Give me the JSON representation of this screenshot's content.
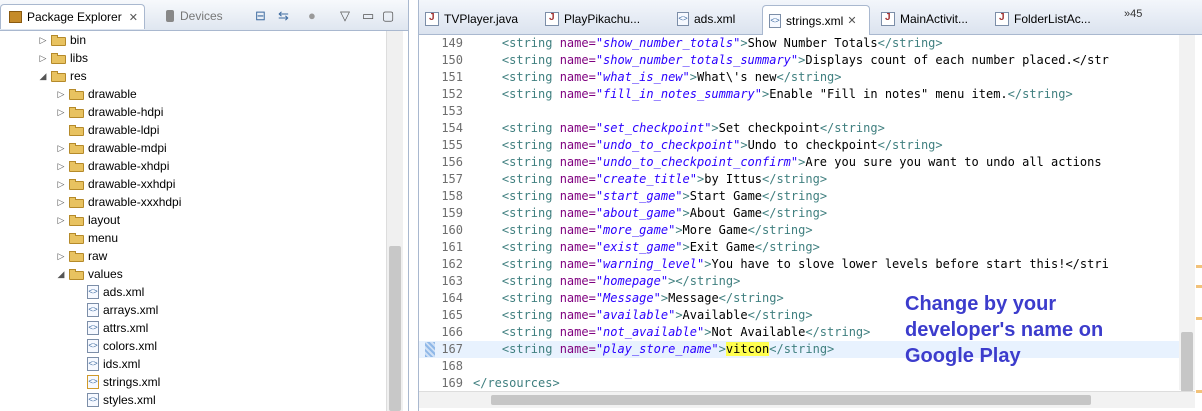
{
  "left_panel": {
    "tabs": [
      {
        "label": "Package Explorer",
        "icon": "package-explorer-icon",
        "active": true
      },
      {
        "label": "Devices",
        "icon": "device-icon",
        "active": false
      }
    ],
    "tree": [
      {
        "label": "bin",
        "type": "folder",
        "depth": 0,
        "state": "collapsed"
      },
      {
        "label": "libs",
        "type": "folder",
        "depth": 0,
        "state": "collapsed"
      },
      {
        "label": "res",
        "type": "folder",
        "depth": 0,
        "state": "expanded"
      },
      {
        "label": "drawable",
        "type": "folder",
        "depth": 1,
        "state": "collapsed"
      },
      {
        "label": "drawable-hdpi",
        "type": "folder",
        "depth": 1,
        "state": "collapsed"
      },
      {
        "label": "drawable-ldpi",
        "type": "folder",
        "depth": 1,
        "state": "none"
      },
      {
        "label": "drawable-mdpi",
        "type": "folder",
        "depth": 1,
        "state": "collapsed"
      },
      {
        "label": "drawable-xhdpi",
        "type": "folder",
        "depth": 1,
        "state": "collapsed"
      },
      {
        "label": "drawable-xxhdpi",
        "type": "folder",
        "depth": 1,
        "state": "collapsed"
      },
      {
        "label": "drawable-xxxhdpi",
        "type": "folder",
        "depth": 1,
        "state": "collapsed"
      },
      {
        "label": "layout",
        "type": "folder",
        "depth": 1,
        "state": "collapsed"
      },
      {
        "label": "menu",
        "type": "folder",
        "depth": 1,
        "state": "none"
      },
      {
        "label": "raw",
        "type": "folder",
        "depth": 1,
        "state": "collapsed"
      },
      {
        "label": "values",
        "type": "folder",
        "depth": 1,
        "state": "expanded"
      },
      {
        "label": "ads.xml",
        "type": "xml",
        "depth": 2
      },
      {
        "label": "arrays.xml",
        "type": "xml",
        "depth": 2
      },
      {
        "label": "attrs.xml",
        "type": "xml",
        "depth": 2
      },
      {
        "label": "colors.xml",
        "type": "xml",
        "depth": 2
      },
      {
        "label": "ids.xml",
        "type": "xml",
        "depth": 2
      },
      {
        "label": "strings.xml",
        "type": "xml",
        "depth": 2,
        "modified": true
      },
      {
        "label": "styles.xml",
        "type": "xml",
        "depth": 2
      }
    ]
  },
  "editor": {
    "tabs": [
      {
        "label": "TVPlayer.java",
        "icon": "java-file-icon"
      },
      {
        "label": "PlayPikachu...",
        "icon": "java-file-icon"
      },
      {
        "label": "ads.xml",
        "icon": "xml-file-icon"
      },
      {
        "label": "strings.xml",
        "icon": "xml-file-icon",
        "active": true
      },
      {
        "label": "MainActivit...",
        "icon": "java-file-icon"
      },
      {
        "label": "FolderListAc...",
        "icon": "java-file-icon"
      }
    ],
    "overflow_label": "»45",
    "lines": [
      {
        "n": "149",
        "name": "show_number_totals",
        "text": "Show Number Totals"
      },
      {
        "n": "150",
        "name": "show_number_totals_summary",
        "text": "Displays count of each number placed.</str"
      },
      {
        "n": "151",
        "name": "what_is_new",
        "text": "What\\'s new"
      },
      {
        "n": "152",
        "name": "fill_in_notes_summary",
        "text": "Enable \"Fill in notes\" menu item."
      },
      {
        "n": "153",
        "blank": true
      },
      {
        "n": "154",
        "name": "set_checkpoint",
        "text": "Set checkpoint"
      },
      {
        "n": "155",
        "name": "undo_to_checkpoint",
        "text": "Undo to checkpoint"
      },
      {
        "n": "156",
        "name": "undo_to_checkpoint_confirm",
        "text": "Are you sure you want to undo all actions"
      },
      {
        "n": "157",
        "name": "create_title",
        "text": "by Ittus"
      },
      {
        "n": "158",
        "name": "start_game",
        "text": "Start Game"
      },
      {
        "n": "159",
        "name": "about_game",
        "text": "About Game"
      },
      {
        "n": "160",
        "name": "more_game",
        "text": "More Game"
      },
      {
        "n": "161",
        "name": "exist_game",
        "text": "Exit Game"
      },
      {
        "n": "162",
        "name": "warning_level",
        "text": "You have to slove lower levels before start this!</stri"
      },
      {
        "n": "163",
        "name": "homepage",
        "text": ""
      },
      {
        "n": "164",
        "name": "Message",
        "text": "Message"
      },
      {
        "n": "165",
        "name": "available",
        "text": "Available"
      },
      {
        "n": "166",
        "name": "not_available",
        "text": "Not Available"
      },
      {
        "n": "167",
        "name": "play_store_name",
        "text": "vitcon",
        "current": true,
        "highlight": true
      },
      {
        "n": "168",
        "blank": true
      },
      {
        "n": "169",
        "closing": "</resources>"
      }
    ]
  },
  "annotation": {
    "text": "Change by your developer's name on Google Play",
    "color": "#3c3ccc"
  }
}
